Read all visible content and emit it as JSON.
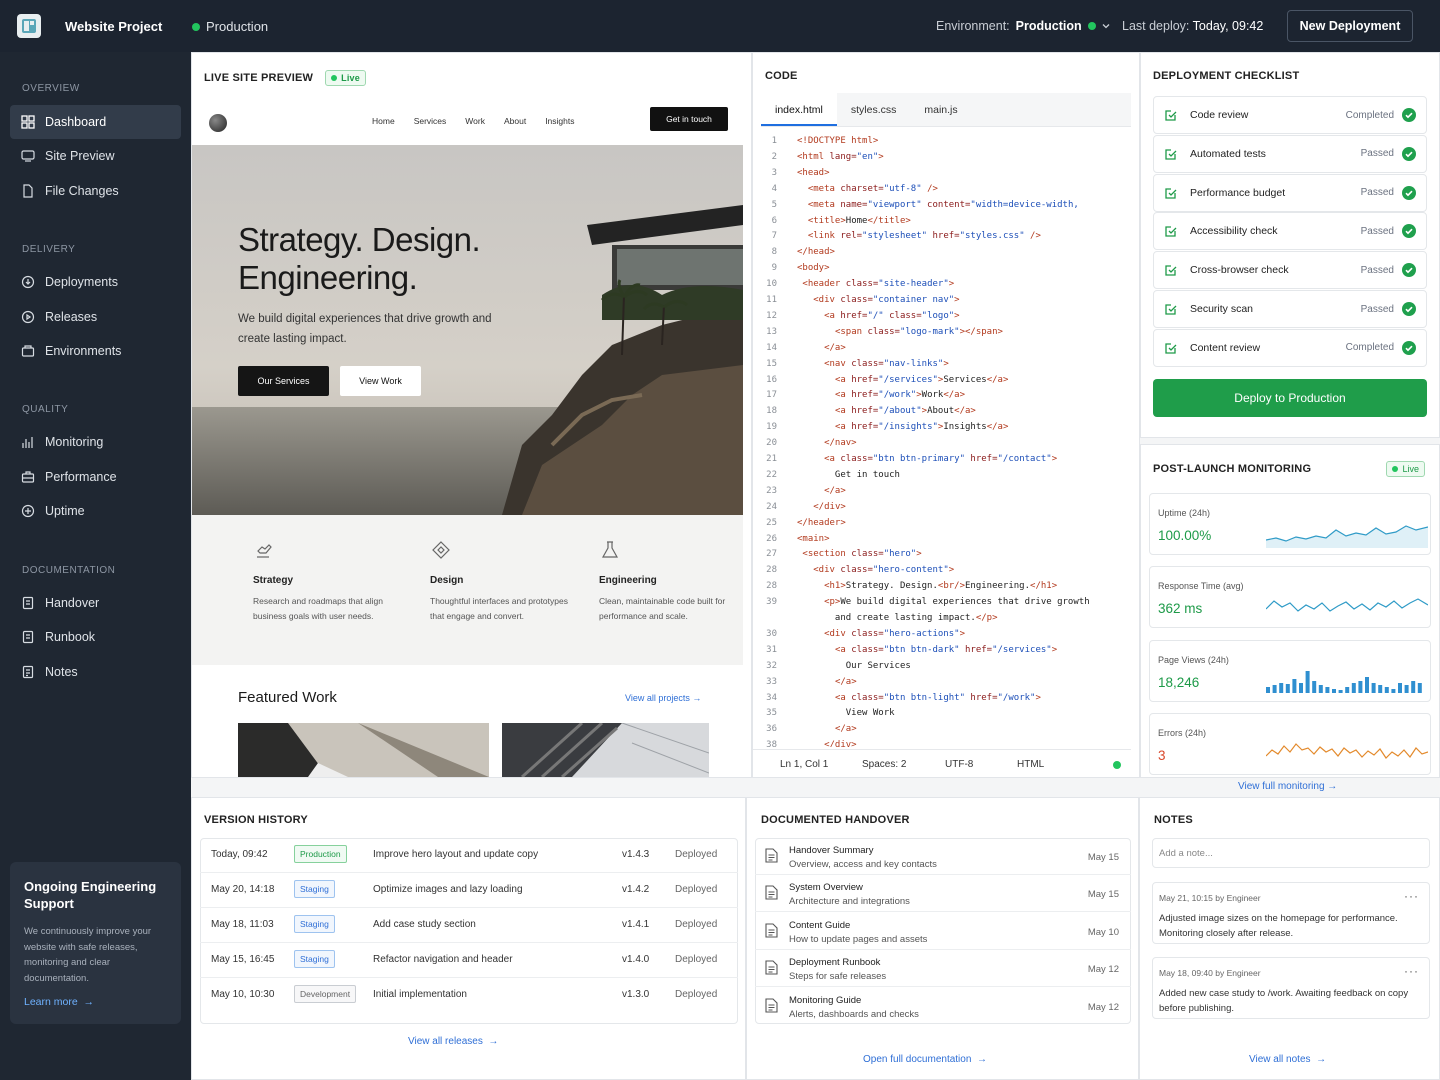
{
  "topbar": {
    "project": "Website Project",
    "status": "Production",
    "env_label": "Environment:",
    "env_value": "Production",
    "last_deploy_label": "Last deploy:",
    "last_deploy_value": "Today, 09:42",
    "new_deployment": "New Deployment"
  },
  "sidebar": {
    "sections": [
      "OVERVIEW",
      "DELIVERY",
      "QUALITY",
      "DOCUMENTATION"
    ],
    "items": [
      "Dashboard",
      "Site Preview",
      "File Changes",
      "Deployments",
      "Releases",
      "Environments",
      "Monitoring",
      "Performance",
      "Uptime",
      "Handover",
      "Runbook",
      "Notes"
    ],
    "support_title": "Ongoing Engineering Support",
    "support_text": "We continuously improve your website with safe releases, monitoring and clear documentation.",
    "support_link": "Learn more"
  },
  "preview": {
    "title": "LIVE SITE PREVIEW",
    "badge": "Live",
    "nav": [
      "Home",
      "Services",
      "Work",
      "About",
      "Insights"
    ],
    "cta": "Get in touch",
    "hero_line1": "Strategy. Design.",
    "hero_line2": "Engineering.",
    "hero_text": "We build digital experiences that drive growth and create lasting impact.",
    "btn_primary": "Our Services",
    "btn_secondary": "View Work",
    "features": [
      {
        "title": "Strategy",
        "text": "Research and roadmaps that align business goals with user needs."
      },
      {
        "title": "Design",
        "text": "Thoughtful interfaces and prototypes that engage and convert."
      },
      {
        "title": "Engineering",
        "text": "Clean, maintainable code built for performance and scale."
      }
    ],
    "featured_title": "Featured Work",
    "featured_link": "View all projects"
  },
  "code": {
    "title": "CODE",
    "tabs": [
      "index.html",
      "styles.css",
      "main.js"
    ],
    "line_numbers": [
      "1",
      "2",
      "3",
      "4",
      "5",
      "6",
      "7",
      "8",
      "9",
      "10",
      "11",
      "12",
      "13",
      "14",
      "15",
      "16",
      "17",
      "18",
      "19",
      "20",
      "21",
      "22",
      "23",
      "24",
      "25",
      "26",
      "27",
      "28",
      "28",
      "39",
      "",
      "30",
      "31",
      "32",
      "33",
      "34",
      "35",
      "36",
      "38"
    ],
    "status": {
      "pos": "Ln 1, Col 1",
      "spaces": "Spaces: 2",
      "encoding": "UTF-8",
      "lang": "HTML"
    }
  },
  "checklist": {
    "title": "DEPLOYMENT CHECKLIST",
    "items": [
      {
        "label": "Code review",
        "status": "Completed"
      },
      {
        "label": "Automated tests",
        "status": "Passed"
      },
      {
        "label": "Performance budget",
        "status": "Passed"
      },
      {
        "label": "Accessibility check",
        "status": "Passed"
      },
      {
        "label": "Cross-browser check",
        "status": "Passed"
      },
      {
        "label": "Security scan",
        "status": "Passed"
      },
      {
        "label": "Content review",
        "status": "Completed"
      }
    ],
    "deploy_button": "Deploy to Production"
  },
  "monitoring": {
    "title": "POST-LAUNCH MONITORING",
    "badge": "Live",
    "metrics": [
      {
        "label": "Uptime (24h)",
        "value": "100.00%"
      },
      {
        "label": "Response Time (avg)",
        "value": "362 ms"
      },
      {
        "label": "Page Views (24h)",
        "value": "18,246"
      },
      {
        "label": "Errors (24h)",
        "value": "3"
      }
    ],
    "link": "View full monitoring"
  },
  "versions": {
    "title": "VERSION HISTORY",
    "rows": [
      {
        "date": "Today, 09:42",
        "env": "Production",
        "desc": "Improve hero layout and update copy",
        "ver": "v1.4.3",
        "status": "Deployed"
      },
      {
        "date": "May 20, 14:18",
        "env": "Staging",
        "desc": "Optimize images and lazy loading",
        "ver": "v1.4.2",
        "status": "Deployed"
      },
      {
        "date": "May 18, 11:03",
        "env": "Staging",
        "desc": "Add case study section",
        "ver": "v1.4.1",
        "status": "Deployed"
      },
      {
        "date": "May 15, 16:45",
        "env": "Staging",
        "desc": "Refactor navigation and header",
        "ver": "v1.4.0",
        "status": "Deployed"
      },
      {
        "date": "May 10, 10:30",
        "env": "Development",
        "desc": "Initial implementation",
        "ver": "v1.3.0",
        "status": "Deployed"
      }
    ],
    "link": "View all releases"
  },
  "handover": {
    "title": "DOCUMENTED HANDOVER",
    "rows": [
      {
        "title": "Handover Summary",
        "sub": "Overview, access and key contacts",
        "date": "May 15"
      },
      {
        "title": "System Overview",
        "sub": "Architecture and integrations",
        "date": "May 15"
      },
      {
        "title": "Content Guide",
        "sub": "How to update pages and assets",
        "date": "May 10"
      },
      {
        "title": "Deployment Runbook",
        "sub": "Steps for safe releases",
        "date": "May 12"
      },
      {
        "title": "Monitoring Guide",
        "sub": "Alerts, dashboards and checks",
        "date": "May 12"
      }
    ],
    "link": "Open full documentation"
  },
  "notes": {
    "title": "NOTES",
    "placeholder": "Add a note...",
    "items": [
      {
        "meta": "May 21, 10:15  by Engineer",
        "body": "Adjusted image sizes on the homepage for performance. Monitoring closely after release."
      },
      {
        "meta": "May 18, 09:40  by Engineer",
        "body": "Added new case study to /work. Awaiting feedback on copy before publishing."
      }
    ],
    "link": "View all notes"
  },
  "colors": {
    "accent": "#1f9d4a",
    "link": "#2f6fd6",
    "sidebar": "#1f2732",
    "topbar": "#1c2430"
  }
}
